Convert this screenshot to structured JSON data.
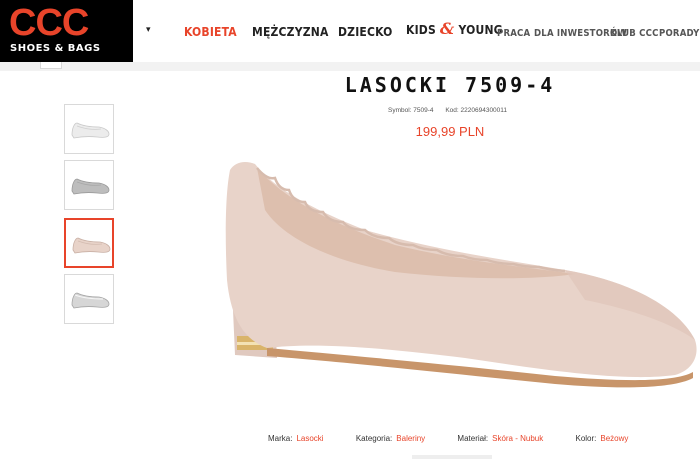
{
  "logo": {
    "main": "CCC",
    "sub": "SHOES & BAGS"
  },
  "menu_toggle": "▾",
  "nav": {
    "kobieta": "KOBIETA",
    "mezczyzna": "MĘŻCZYZNA",
    "dziecko": "DZIECKO",
    "kids_a": "KIDS",
    "kids_amp": "&",
    "kids_b": "YOUNG",
    "praca": "PRACA",
    "inwestorzy": "DLA INWESTORÓW",
    "klub": "KLUB CCC",
    "porady": "PORADY"
  },
  "product": {
    "title": "LASOCKI 7509-4",
    "symbol": "Symbol: 7509-4",
    "kod": "Kod: 2220694300011",
    "price": "199,99 PLN"
  },
  "attributes": {
    "marka_label": "Marka:",
    "marka_value": "Lasocki",
    "kategoria_label": "Kategoria:",
    "kategoria_value": "Baleriny",
    "material_label": "Materiał:",
    "material_value": "Skóra - Nubuk",
    "kolor_label": "Kolor:",
    "kolor_value": "Beżowy"
  },
  "colors": {
    "accent": "#e8442a",
    "shoe_beige": "#e8d3c9",
    "gold": "#d9b46a"
  },
  "thumbnails": [
    {
      "variant": "light-grey-shoe"
    },
    {
      "variant": "grey-shoe"
    },
    {
      "variant": "beige-shoe",
      "selected": true
    },
    {
      "variant": "silver-shoe"
    }
  ]
}
